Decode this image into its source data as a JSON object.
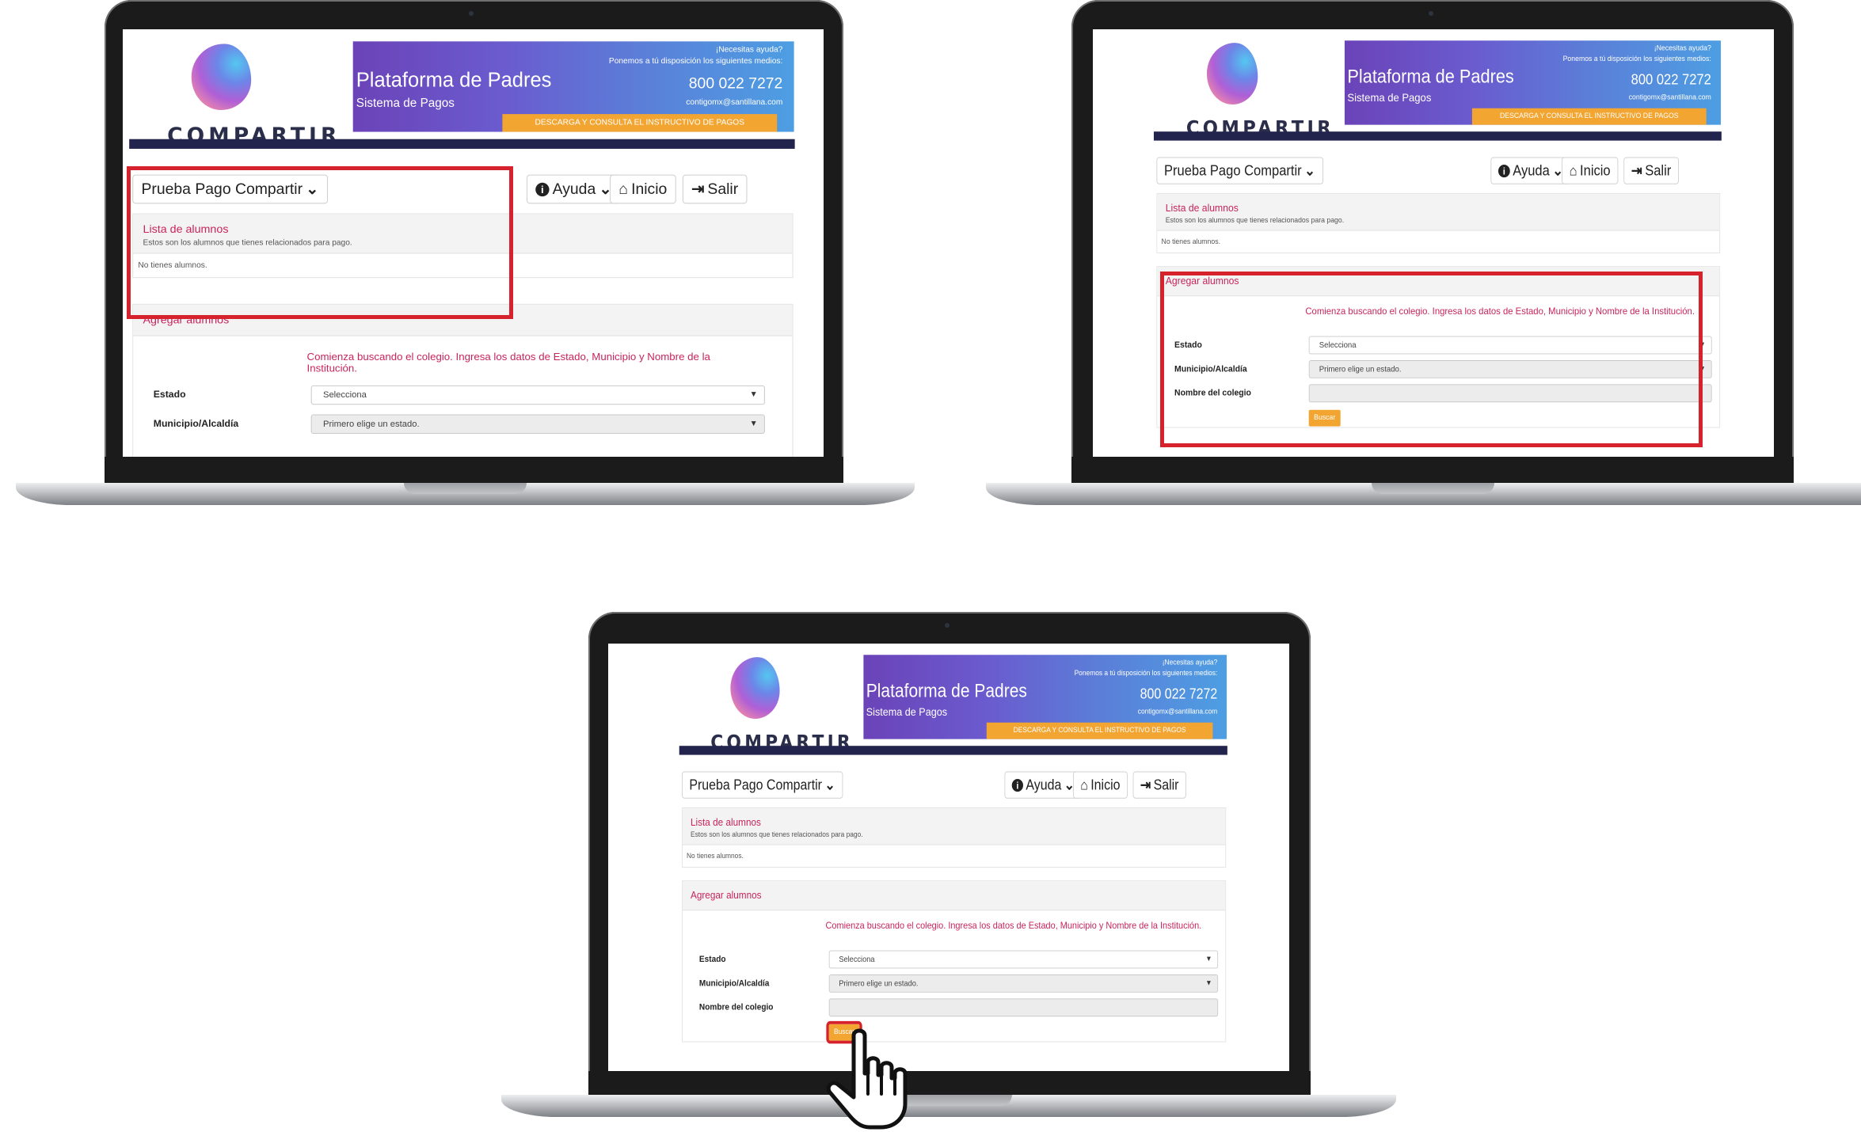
{
  "app": {
    "logo_text": "COMPARTIR",
    "banner_title": "Plataforma de Padres",
    "banner_subtitle": "Sistema de Pagos",
    "help_question": "¡Necesitas ayuda?",
    "help_line": "Ponemos a tú disposición los siguientes medios:",
    "phone": "800 022 7272",
    "email": "contigomx@santillana.com",
    "cta": "DESCARGA Y CONSULTA EL INSTRUCTIVO DE PAGOS"
  },
  "nav": {
    "user_menu": "Prueba Pago Compartir",
    "help": "Ayuda",
    "home": "Inicio",
    "logout": "Salir"
  },
  "students": {
    "title": "Lista de alumnos",
    "subtitle": "Estos son los alumnos que tienes relacionados para pago.",
    "empty": "No tienes alumnos."
  },
  "add": {
    "title": "Agregar alumnos",
    "instructions": "Comienza buscando el colegio. Ingresa los datos de Estado, Municipio y Nombre de la Institución.",
    "state_label": "Estado",
    "state_value": "Selecciona",
    "municipality_label": "Municipio/Alcaldía",
    "municipality_value": "Primero elige un estado.",
    "school_label": "Nombre del colegio",
    "search_button": "Buscar"
  },
  "colors": {
    "accent_pink": "#c8245d",
    "cta_orange": "#f2a531",
    "nav_navy": "#23244d",
    "highlight_red": "#d6222c"
  }
}
